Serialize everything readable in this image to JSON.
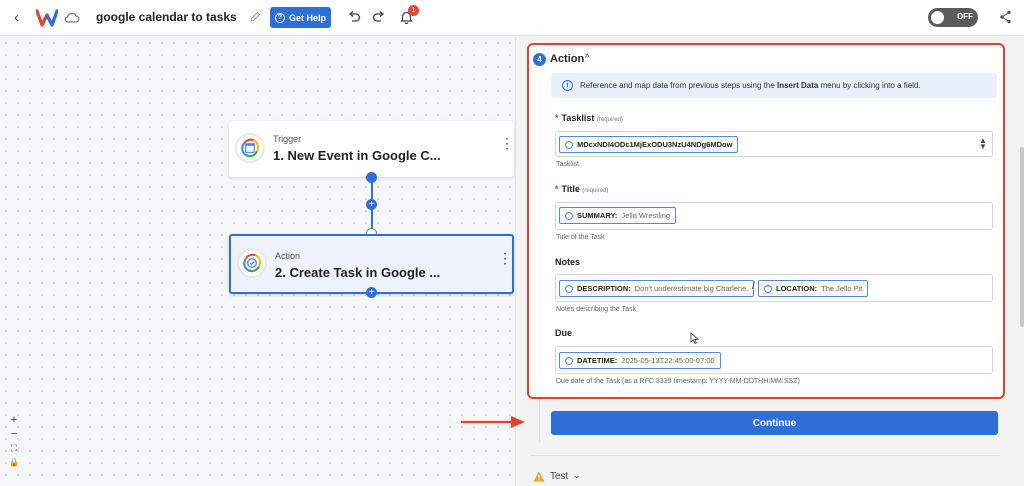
{
  "topbar": {
    "title": "google calendar to tasks",
    "help_label": "Get Help",
    "help_icon_glyph": "?",
    "back_glyph": "‹",
    "notification_count": "1",
    "toggle_label": "OFF",
    "brand_color": "#e0432f",
    "accent_color": "#2e6fd8"
  },
  "flow": {
    "trigger": {
      "type": "Trigger",
      "name": "1. New Event in Google C..."
    },
    "action": {
      "type": "Action",
      "name": "2. Create Task in Google ..."
    },
    "menu_glyph": "⋮",
    "add_glyph": "+"
  },
  "zoom_controls": {
    "zoom_in": "+",
    "zoom_out": "−",
    "fit": "⛶",
    "lock": "🔒"
  },
  "panel": {
    "step_number": "4",
    "section_title": "Action",
    "collapse_glyph": "^",
    "info": {
      "icon_glyph": "i",
      "text_before": "Reference and map data from previous steps using the ",
      "text_bold": "Insert Data",
      "text_after": " menu by clicking into a field."
    },
    "required_mark": "*",
    "fields": {
      "tasklist": {
        "label": "Tasklist",
        "required_note": "(required)",
        "value": "MDcxNDI4ODc1MjExODU3NzU4NDg6MDow",
        "help": "Tasklist",
        "stepper_up": "▲",
        "stepper_down": "▼"
      },
      "title": {
        "label": "Title",
        "required_note": "(required)",
        "pill_key": "SUMMARY:",
        "pill_value": "Jello Wrestling",
        "help": "Title of the Task"
      },
      "notes": {
        "label": "Notes",
        "pill1_key": "DESCRIPTION:",
        "pill1_value": "Don't underestimate big Charlene.",
        "separator": "/",
        "pill2_key": "LOCATION:",
        "pill2_value": "The Jello Pit",
        "help": "Notes describing the Task"
      },
      "due": {
        "label": "Due",
        "pill_key": "DATETIME:",
        "pill_value": "2025-05-13T22:45:00-07:00",
        "help": "Due date of the Task (as a RFC 3339 timestamp: YYYY-MM-DDTHH:MM:SSZ)"
      }
    },
    "continue_label": "Continue",
    "test_label": "Test",
    "test_chevron": "⌄"
  }
}
